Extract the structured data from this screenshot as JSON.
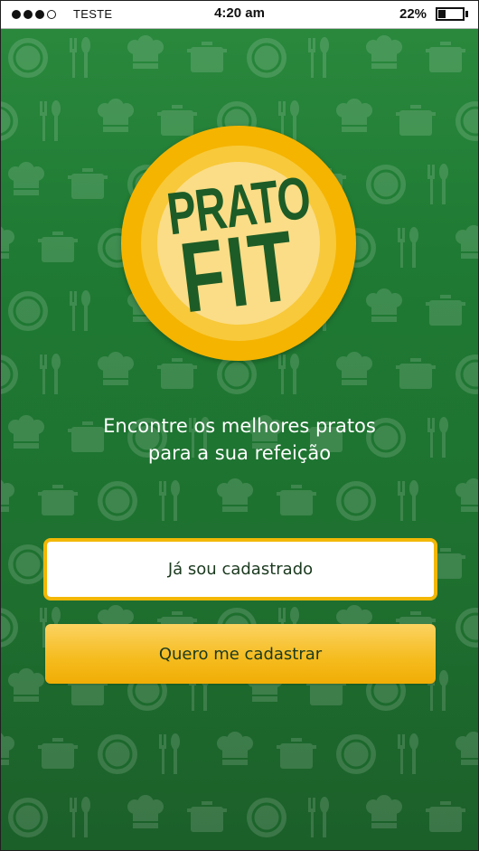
{
  "status_bar": {
    "carrier": "TESTE",
    "time": "4:20 am",
    "battery_percent": "22%",
    "battery_level": 0.22,
    "signal_bars_filled": 3,
    "signal_bars_total": 4
  },
  "logo": {
    "line1": "PRATO",
    "line2": "FIT",
    "colors": {
      "plate": "#f5b400",
      "text": "#1d5c26"
    }
  },
  "tagline": {
    "line1": "Encontre os melhores pratos",
    "line2": "para a sua refeição"
  },
  "buttons": {
    "login": "Já sou cadastrado",
    "register": "Quero me cadastrar"
  },
  "colors": {
    "background": "#1f7a33",
    "accent": "#f2b705",
    "button_text": "#1b3a1f"
  },
  "icons": [
    "chef-hat-icon",
    "pot-icon",
    "plate-icon",
    "fork-knife-icon",
    "spoon-icon",
    "cup-icon"
  ]
}
